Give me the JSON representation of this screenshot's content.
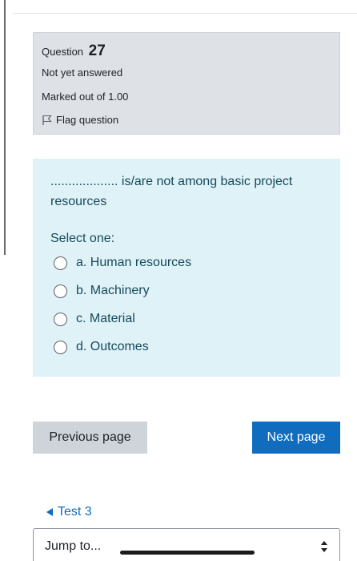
{
  "question": {
    "label": "Question",
    "number": "27",
    "status": "Not yet answered",
    "marks": "Marked out of 1.00",
    "flag_label": "Flag question"
  },
  "content": {
    "question_text": "................... is/are not among basic project resources",
    "prompt": "Select one:",
    "options": [
      {
        "label": "a. Human resources"
      },
      {
        "label": "b. Machinery"
      },
      {
        "label": "c. Material"
      },
      {
        "label": "d. Outcomes"
      }
    ]
  },
  "navigation": {
    "previous_label": "Previous page",
    "next_label": "Next page",
    "back_link": "Test 3",
    "jump_label": "Jump to..."
  },
  "colors": {
    "info_bg": "#dee2e6",
    "content_bg": "#def2f8",
    "primary": "#0f6cbf",
    "text_dark": "#18495a"
  }
}
